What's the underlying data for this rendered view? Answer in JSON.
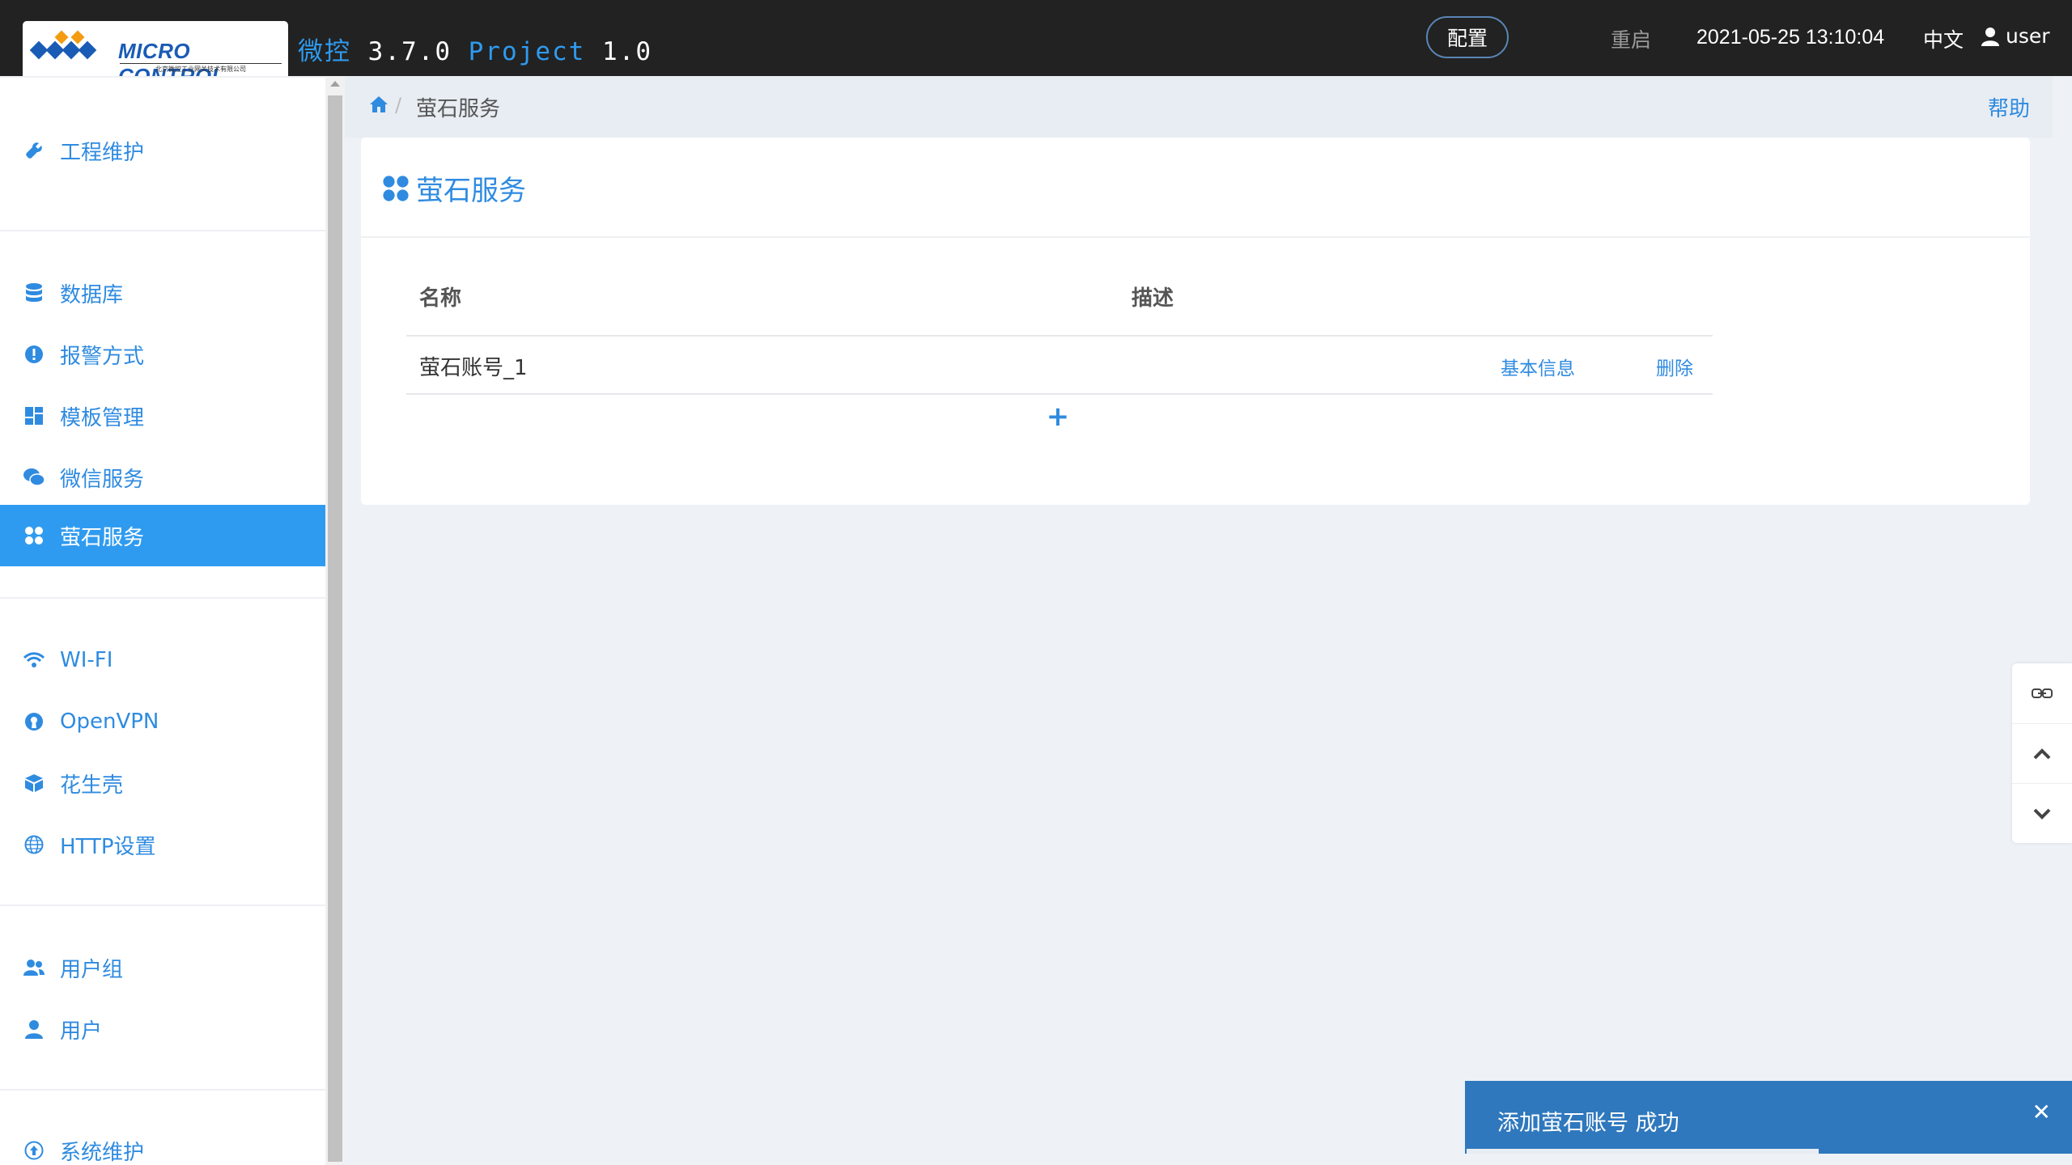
{
  "header": {
    "logo_text": "MICRO CONTROL",
    "logo_subtext": "北京微控工业网关技术有限公司",
    "title_cn": "微控",
    "version": "3.7.0",
    "project_label": "Project",
    "project_version": "1.0",
    "config_label": "配置",
    "restart_label": "重启",
    "datetime": "2021-05-25 13:10:04",
    "language": "中文",
    "username": "user"
  },
  "sidebar": {
    "items": [
      {
        "label": "工程维护",
        "icon": "wrench-icon"
      },
      {
        "label": "数据库",
        "icon": "database-icon"
      },
      {
        "label": "报警方式",
        "icon": "alert-icon"
      },
      {
        "label": "模板管理",
        "icon": "dashboard-icon"
      },
      {
        "label": "微信服务",
        "icon": "wechat-icon"
      },
      {
        "label": "萤石服务",
        "icon": "fan-icon",
        "active": true
      },
      {
        "label": "WI-FI",
        "icon": "wifi-icon"
      },
      {
        "label": "OpenVPN",
        "icon": "openvpn-icon"
      },
      {
        "label": "花生壳",
        "icon": "cube-icon"
      },
      {
        "label": "HTTP设置",
        "icon": "globe-icon"
      },
      {
        "label": "用户组",
        "icon": "users-icon"
      },
      {
        "label": "用户",
        "icon": "user-icon"
      },
      {
        "label": "系统维护",
        "icon": "upload-circle-icon"
      }
    ]
  },
  "breadcrumb": {
    "current": "萤石服务",
    "help": "帮助"
  },
  "panel": {
    "title": "萤石服务",
    "columns": [
      "名称",
      "描述"
    ],
    "rows": [
      {
        "name": "萤石账号_1",
        "description": "",
        "info_action": "基本信息",
        "delete_action": "删除"
      }
    ]
  },
  "toast": {
    "message": "添加萤石账号 成功",
    "progress": 0.58
  },
  "colors": {
    "accent": "#2f9bf0",
    "topbar": "#222222",
    "toast": "#2f78bd"
  }
}
